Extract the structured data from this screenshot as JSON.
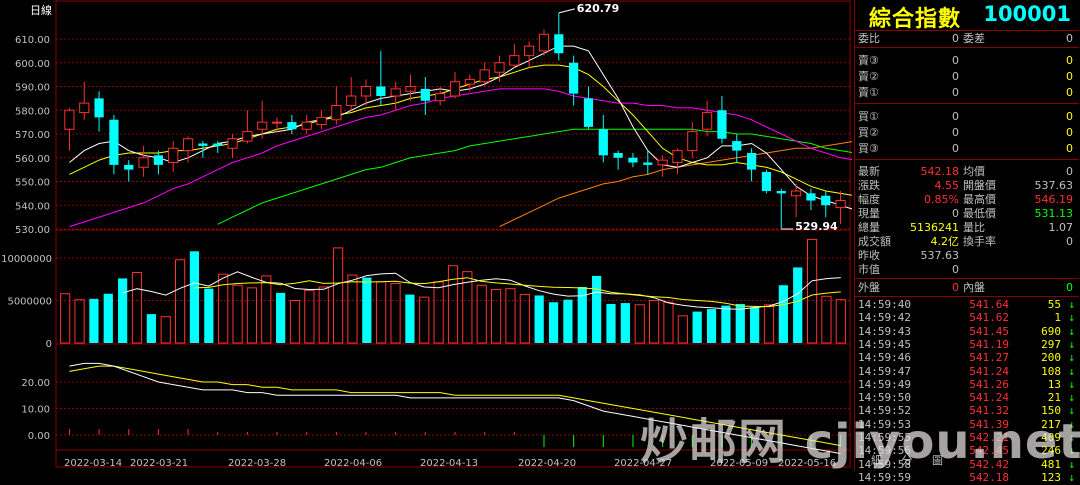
{
  "chart": {
    "period_label": "日線",
    "high_callout": "620.79",
    "low_callout": "529.94",
    "y_ticks": [
      "610.00",
      "600.00",
      "590.00",
      "580.00",
      "570.00",
      "560.00",
      "550.00",
      "540.00",
      "530.00"
    ],
    "vol_ticks": [
      "10000000",
      "5000000",
      "0"
    ],
    "ind_ticks": [
      "20.00",
      "10.00",
      "0.00"
    ],
    "dates": [
      "2022-03-14",
      "2022-03-21",
      "2022-03-28",
      "2022-04-06",
      "2022-04-13",
      "2022-04-20",
      "2022-04-27",
      "2022-05-09",
      "2022-05-16"
    ],
    "colors": {
      "up": "#ff3030",
      "down": "#00ffff",
      "ma5": "#ffffff",
      "ma10": "#ffff00",
      "ma20": "#ff00ff",
      "ma60": "#00ff00",
      "ma120": "#ff8000",
      "grid": "#8b0000"
    }
  },
  "chart_data": {
    "type": "candlestick",
    "ylim": [
      530,
      620
    ],
    "candles": [
      [
        572,
        580,
        581,
        563
      ],
      [
        579,
        583,
        592,
        576
      ],
      [
        585,
        577,
        588,
        571
      ],
      [
        576,
        557,
        578,
        553
      ],
      [
        557,
        555,
        559,
        550
      ],
      [
        556,
        560,
        565,
        552
      ],
      [
        561,
        557,
        563,
        553
      ],
      [
        558,
        564,
        567,
        554
      ],
      [
        563,
        568,
        569,
        558
      ],
      [
        566,
        565,
        567,
        560
      ],
      [
        566,
        565,
        567,
        562
      ],
      [
        564,
        568,
        570,
        560
      ],
      [
        567,
        571,
        580,
        566
      ],
      [
        572,
        575,
        584,
        568
      ],
      [
        575,
        575,
        577,
        571
      ],
      [
        575,
        572,
        578,
        570
      ],
      [
        572,
        575,
        578,
        570
      ],
      [
        574,
        577,
        580,
        572
      ],
      [
        576,
        582,
        590,
        574
      ],
      [
        582,
        586,
        594,
        580
      ],
      [
        586,
        590,
        593,
        582
      ],
      [
        590,
        586,
        605,
        582
      ],
      [
        586,
        589,
        592,
        580
      ],
      [
        588,
        590,
        595,
        584
      ],
      [
        589,
        584,
        594,
        578
      ],
      [
        584,
        587,
        590,
        582
      ],
      [
        586,
        592,
        596,
        585
      ],
      [
        591,
        593,
        595,
        588
      ],
      [
        592,
        597,
        600,
        590
      ],
      [
        596,
        600,
        603,
        592
      ],
      [
        599,
        603,
        608,
        598
      ],
      [
        603,
        607,
        609,
        598
      ],
      [
        605,
        612,
        614,
        603
      ],
      [
        612,
        604,
        621,
        601
      ],
      [
        600,
        587,
        603,
        582
      ],
      [
        585,
        573,
        590,
        572
      ],
      [
        572,
        561,
        578,
        558
      ],
      [
        562,
        560,
        563,
        555
      ],
      [
        560,
        558,
        562,
        556
      ],
      [
        558,
        557,
        563,
        553
      ],
      [
        557,
        559,
        561,
        552
      ],
      [
        558,
        563,
        564,
        553
      ],
      [
        563,
        571,
        575,
        560
      ],
      [
        572,
        579,
        584,
        569
      ],
      [
        580,
        568,
        586,
        566
      ],
      [
        567,
        563,
        570,
        558
      ],
      [
        562,
        555,
        564,
        550
      ],
      [
        554,
        546,
        555,
        545
      ],
      [
        546,
        545,
        547,
        530
      ],
      [
        544,
        546,
        549,
        535
      ],
      [
        545,
        542,
        547,
        538
      ],
      [
        544,
        540,
        546,
        535
      ],
      [
        539,
        542,
        546,
        532
      ]
    ],
    "volume": [
      5.8,
      5.1,
      5.2,
      5.8,
      7.6,
      8.3,
      3.4,
      3.1,
      9.8,
      10.8,
      6.4,
      8.1,
      6.8,
      6.5,
      7.9,
      5.9,
      5.0,
      6.2,
      6.6,
      11.2,
      8.0,
      7.7,
      7.2,
      7.0,
      5.7,
      5.4,
      7.2,
      9.1,
      8.4,
      6.8,
      6.3,
      6.4,
      5.7,
      5.6,
      4.8,
      5.1,
      6.6,
      7.9,
      4.6,
      4.7,
      4.5,
      5.0,
      4.8,
      3.2,
      3.7,
      4.0,
      4.4,
      4.6,
      4.2,
      4.5,
      6.8,
      8.9,
      12.2,
      5.5,
      5.1
    ],
    "ma5": [
      558,
      563,
      566,
      567,
      563,
      561,
      560,
      558,
      560,
      563,
      566,
      567,
      569,
      570,
      571,
      572,
      575,
      576,
      577,
      580,
      583,
      585,
      586,
      587,
      588,
      589,
      588,
      589,
      591,
      594,
      598,
      601,
      604,
      607,
      607,
      605,
      595,
      585,
      573,
      563,
      557,
      556,
      558,
      560,
      565,
      565,
      566,
      562,
      555,
      548,
      544,
      542,
      540,
      538
    ],
    "ma10": [
      553,
      556,
      559,
      561,
      562,
      562,
      562,
      563,
      563,
      564,
      565,
      566,
      568,
      570,
      572,
      573,
      574,
      576,
      578,
      579,
      581,
      582,
      583,
      585,
      586,
      587,
      589,
      591,
      593,
      594,
      596,
      598,
      599,
      599,
      598,
      595,
      590,
      584,
      578,
      571,
      564,
      560,
      558,
      557,
      557,
      558,
      557,
      556,
      554,
      551,
      548,
      546,
      545,
      544
    ],
    "ma20": [
      531,
      533,
      535,
      537,
      539,
      541,
      544,
      547,
      549,
      552,
      555,
      558,
      560,
      562,
      565,
      567,
      569,
      571,
      573,
      575,
      577,
      578,
      580,
      582,
      583,
      585,
      586,
      587,
      588,
      589,
      589,
      589,
      589,
      588,
      586,
      585,
      584,
      583,
      583,
      582,
      582,
      581,
      581,
      580,
      579,
      578,
      576,
      573,
      570,
      567,
      564,
      562,
      560,
      559
    ],
    "ma60": [
      null,
      null,
      null,
      null,
      null,
      null,
      null,
      null,
      null,
      null,
      532,
      535,
      538,
      541,
      543,
      545,
      547,
      549,
      551,
      553,
      555,
      556,
      558,
      560,
      561,
      562,
      563,
      565,
      566,
      567,
      568,
      569,
      570,
      571,
      572,
      572,
      572,
      572,
      572,
      572,
      572,
      572,
      572,
      571,
      571,
      570,
      570,
      569,
      568,
      567,
      566,
      564,
      563,
      562
    ],
    "ma120": [
      null,
      null,
      null,
      null,
      null,
      null,
      null,
      null,
      null,
      null,
      null,
      null,
      null,
      null,
      null,
      null,
      null,
      null,
      null,
      null,
      null,
      null,
      null,
      null,
      null,
      null,
      null,
      null,
      null,
      531,
      534,
      537,
      540,
      543,
      545,
      547,
      549,
      550,
      552,
      553,
      555,
      556,
      557,
      558,
      559,
      560,
      561,
      562,
      563,
      564,
      564,
      565,
      566,
      567
    ]
  },
  "panel": {
    "title": "綜合指數",
    "code": "100001",
    "rows_top": [
      {
        "l": "委比",
        "v": "0",
        "l2": "委差",
        "v2": "0"
      }
    ],
    "orderbook": [
      {
        "l": "賣③",
        "v": "0",
        "v2": "0"
      },
      {
        "l": "賣②",
        "v": "0",
        "v2": "0"
      },
      {
        "l": "賣①",
        "v": "0",
        "v2": "0"
      },
      {
        "l": "買①",
        "v": "0",
        "v2": "0"
      },
      {
        "l": "買②",
        "v": "0",
        "v2": "0"
      },
      {
        "l": "買③",
        "v": "0",
        "v2": "0"
      }
    ],
    "stats": [
      {
        "l": "最新",
        "v": "542.18",
        "vc": "#ff3030",
        "l2": "均價",
        "v2": "0",
        "v2c": "#c0c0c0"
      },
      {
        "l": "漲跌",
        "v": "4.55",
        "vc": "#ff3030",
        "l2": "開盤價",
        "v2": "537.63",
        "v2c": "#c0c0c0"
      },
      {
        "l": "幅度",
        "v": "0.85%",
        "vc": "#ff3030",
        "l2": "最高價",
        "v2": "546.19",
        "v2c": "#ff3030"
      },
      {
        "l": "現量",
        "v": "0",
        "vc": "#c0c0c0",
        "l2": "最低價",
        "v2": "531.13",
        "v2c": "#00ff00"
      },
      {
        "l": "總量",
        "v": "5136241",
        "vc": "#ffff00",
        "l2": "量比",
        "v2": "1.07",
        "v2c": "#c0c0c0"
      },
      {
        "l": "成交額",
        "v": "4.2亿",
        "vc": "#ffff00",
        "l2": "換手率",
        "v2": "0",
        "v2c": "#c0c0c0"
      },
      {
        "l": "昨收",
        "v": "537.63",
        "vc": "#c0c0c0",
        "l2": "",
        "v2": "",
        "v2c": "#c0c0c0"
      },
      {
        "l": "市值",
        "v": "0",
        "vc": "#c0c0c0",
        "l2": "",
        "v2": "",
        "v2c": "#c0c0c0"
      }
    ],
    "outer_label": "外盤",
    "outer_value": "0",
    "inner_label": "內盤",
    "inner_value": "0",
    "ticks": [
      {
        "t": "14:59:40",
        "p": "541.64",
        "q": "55",
        "a": "↓"
      },
      {
        "t": "14:59:42",
        "p": "541.62",
        "q": "1",
        "a": "↓"
      },
      {
        "t": "14:59:43",
        "p": "541.45",
        "q": "690",
        "a": "↓"
      },
      {
        "t": "14:59:45",
        "p": "541.19",
        "q": "297",
        "a": "↓"
      },
      {
        "t": "14:59:46",
        "p": "541.27",
        "q": "200",
        "a": "↓"
      },
      {
        "t": "14:59:47",
        "p": "541.24",
        "q": "108",
        "a": "↓"
      },
      {
        "t": "14:59:49",
        "p": "541.26",
        "q": "13",
        "a": "↓"
      },
      {
        "t": "14:59:50",
        "p": "541.24",
        "q": "21",
        "a": "↓"
      },
      {
        "t": "14:59:52",
        "p": "541.32",
        "q": "150",
        "a": "↓"
      },
      {
        "t": "14:59:53",
        "p": "541.39",
        "q": "217",
        "a": "↓"
      },
      {
        "t": "14:59:55",
        "p": "542.21",
        "q": "409",
        "a": "↓"
      },
      {
        "t": "14:59:56",
        "p": "542.45",
        "q": "246",
        "a": "↓"
      },
      {
        "t": "14:59:58",
        "p": "542.42",
        "q": "481",
        "a": "↓"
      },
      {
        "t": "14:59:59",
        "p": "542.18",
        "q": "123",
        "a": "↓"
      }
    ],
    "tabs": [
      "細",
      "分",
      "圖"
    ]
  },
  "watermark": "炒邮网 cjiyou.net"
}
